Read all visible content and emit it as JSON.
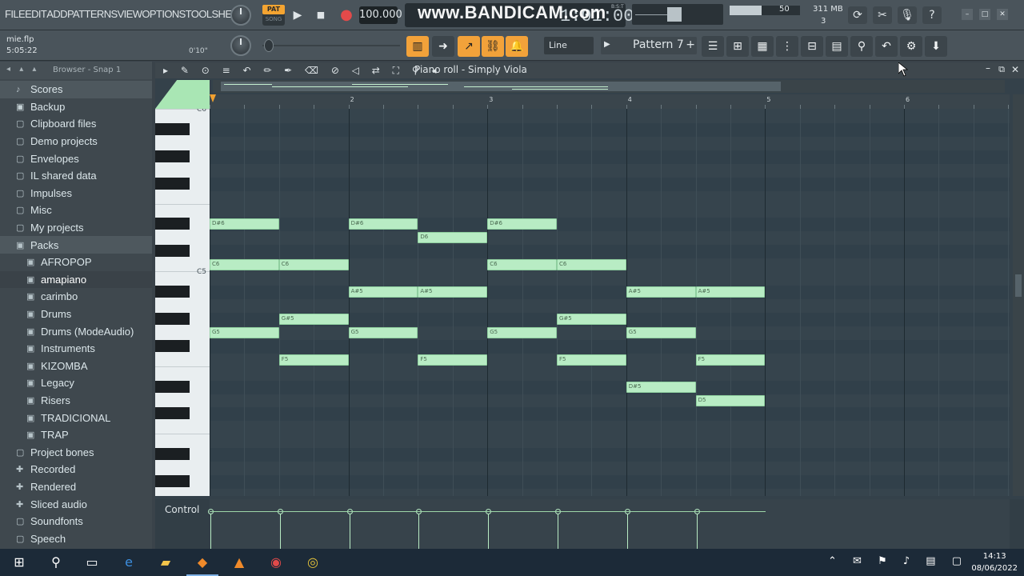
{
  "menu": [
    "FILE",
    "EDIT",
    "ADD",
    "PATTERNS",
    "VIEW",
    "OPTIONS",
    "TOOLS",
    "HELP"
  ],
  "transport": {
    "pat_label": "PAT",
    "song_label": "SONG",
    "tempo": "100.000",
    "watermark": "www.BANDICAM.com",
    "timecode": "1:01:00",
    "time_unit": "B:S:T"
  },
  "monitor": {
    "cpu": "50",
    "memory": "311 MB",
    "polyphony": "3",
    "cpu_level": 0.45
  },
  "project": {
    "filename": "mie.flp",
    "song_time": "5:05:22",
    "hint_time": "0'10\""
  },
  "piano_toolbar": {
    "snap": "Line",
    "pattern": "Pattern 7"
  },
  "browser": {
    "title": "Browser - Snap 1",
    "items": [
      {
        "label": "Scores",
        "level": 0,
        "icon": "♪",
        "style": "active"
      },
      {
        "label": "Backup",
        "level": 0,
        "icon": "▣",
        "style": "open"
      },
      {
        "label": "Clipboard files",
        "level": 0,
        "icon": "▢"
      },
      {
        "label": "Demo projects",
        "level": 0,
        "icon": "▢"
      },
      {
        "label": "Envelopes",
        "level": 0,
        "icon": "▢"
      },
      {
        "label": "IL shared data",
        "level": 0,
        "icon": "▢"
      },
      {
        "label": "Impulses",
        "level": 0,
        "icon": "▢"
      },
      {
        "label": "Misc",
        "level": 0,
        "icon": "▢"
      },
      {
        "label": "My projects",
        "level": 0,
        "icon": "▢"
      },
      {
        "label": "Packs",
        "level": 0,
        "icon": "▣",
        "style": "active"
      },
      {
        "label": "AFROPOP",
        "level": 1,
        "icon": "▣"
      },
      {
        "label": "amapiano",
        "level": 1,
        "icon": "▣",
        "style": "selected"
      },
      {
        "label": "carimbo",
        "level": 1,
        "icon": "▣"
      },
      {
        "label": "Drums",
        "level": 1,
        "icon": "▣"
      },
      {
        "label": "Drums (ModeAudio)",
        "level": 1,
        "icon": "▣"
      },
      {
        "label": "Instruments",
        "level": 1,
        "icon": "▣"
      },
      {
        "label": "KIZOMBA",
        "level": 1,
        "icon": "▣"
      },
      {
        "label": "Legacy",
        "level": 1,
        "icon": "▣"
      },
      {
        "label": "Risers",
        "level": 1,
        "icon": "▣"
      },
      {
        "label": "TRADICIONAL",
        "level": 1,
        "icon": "▣"
      },
      {
        "label": "TRAP",
        "level": 1,
        "icon": "▣"
      },
      {
        "label": "Project bones",
        "level": 0,
        "icon": "▢"
      },
      {
        "label": "Recorded",
        "level": 0,
        "icon": "✚"
      },
      {
        "label": "Rendered",
        "level": 0,
        "icon": "✚"
      },
      {
        "label": "Sliced audio",
        "level": 0,
        "icon": "✚"
      },
      {
        "label": "Soundfonts",
        "level": 0,
        "icon": "▢"
      },
      {
        "label": "Speech",
        "level": 0,
        "icon": "▢"
      }
    ]
  },
  "piano_roll": {
    "title": "Piano roll - Simply Viola",
    "bar_numbers": [
      "2",
      "3",
      "4",
      "5",
      "6"
    ],
    "key_labels": [
      "C6",
      "C5"
    ],
    "control_label": "Control",
    "notes": [
      {
        "label": "D#6",
        "pitch": 63,
        "start": 0,
        "len": 2
      },
      {
        "label": "C6",
        "pitch": 60,
        "start": 0,
        "len": 2
      },
      {
        "label": "G5",
        "pitch": 55,
        "start": 0,
        "len": 2
      },
      {
        "label": "C6",
        "pitch": 60,
        "start": 2,
        "len": 2
      },
      {
        "label": "G#5",
        "pitch": 56,
        "start": 2,
        "len": 2
      },
      {
        "label": "F5",
        "pitch": 53,
        "start": 2,
        "len": 2
      },
      {
        "label": "D#6",
        "pitch": 63,
        "start": 4,
        "len": 2
      },
      {
        "label": "A#5",
        "pitch": 58,
        "start": 4,
        "len": 2
      },
      {
        "label": "G5",
        "pitch": 55,
        "start": 4,
        "len": 2
      },
      {
        "label": "D6",
        "pitch": 62,
        "start": 6,
        "len": 2
      },
      {
        "label": "A#5",
        "pitch": 58,
        "start": 6,
        "len": 2
      },
      {
        "label": "F5",
        "pitch": 53,
        "start": 6,
        "len": 2
      },
      {
        "label": "D#6",
        "pitch": 63,
        "start": 8,
        "len": 2
      },
      {
        "label": "C6",
        "pitch": 60,
        "start": 8,
        "len": 2
      },
      {
        "label": "G5",
        "pitch": 55,
        "start": 8,
        "len": 2
      },
      {
        "label": "C6",
        "pitch": 60,
        "start": 10,
        "len": 2
      },
      {
        "label": "G#5",
        "pitch": 56,
        "start": 10,
        "len": 2
      },
      {
        "label": "F5",
        "pitch": 53,
        "start": 10,
        "len": 2
      },
      {
        "label": "A#5",
        "pitch": 58,
        "start": 12,
        "len": 2
      },
      {
        "label": "G5",
        "pitch": 55,
        "start": 12,
        "len": 2
      },
      {
        "label": "D#5",
        "pitch": 51,
        "start": 12,
        "len": 2
      },
      {
        "label": "A#5",
        "pitch": 58,
        "start": 14,
        "len": 2
      },
      {
        "label": "F5",
        "pitch": 53,
        "start": 14,
        "len": 2
      },
      {
        "label": "D5",
        "pitch": 50,
        "start": 14,
        "len": 2
      }
    ]
  },
  "taskbar": {
    "time": "14:13",
    "date": "08/06/2022"
  },
  "colors": {
    "note": "#b8ecc4",
    "accent": "#f2a23a",
    "background": "#3a434a"
  }
}
